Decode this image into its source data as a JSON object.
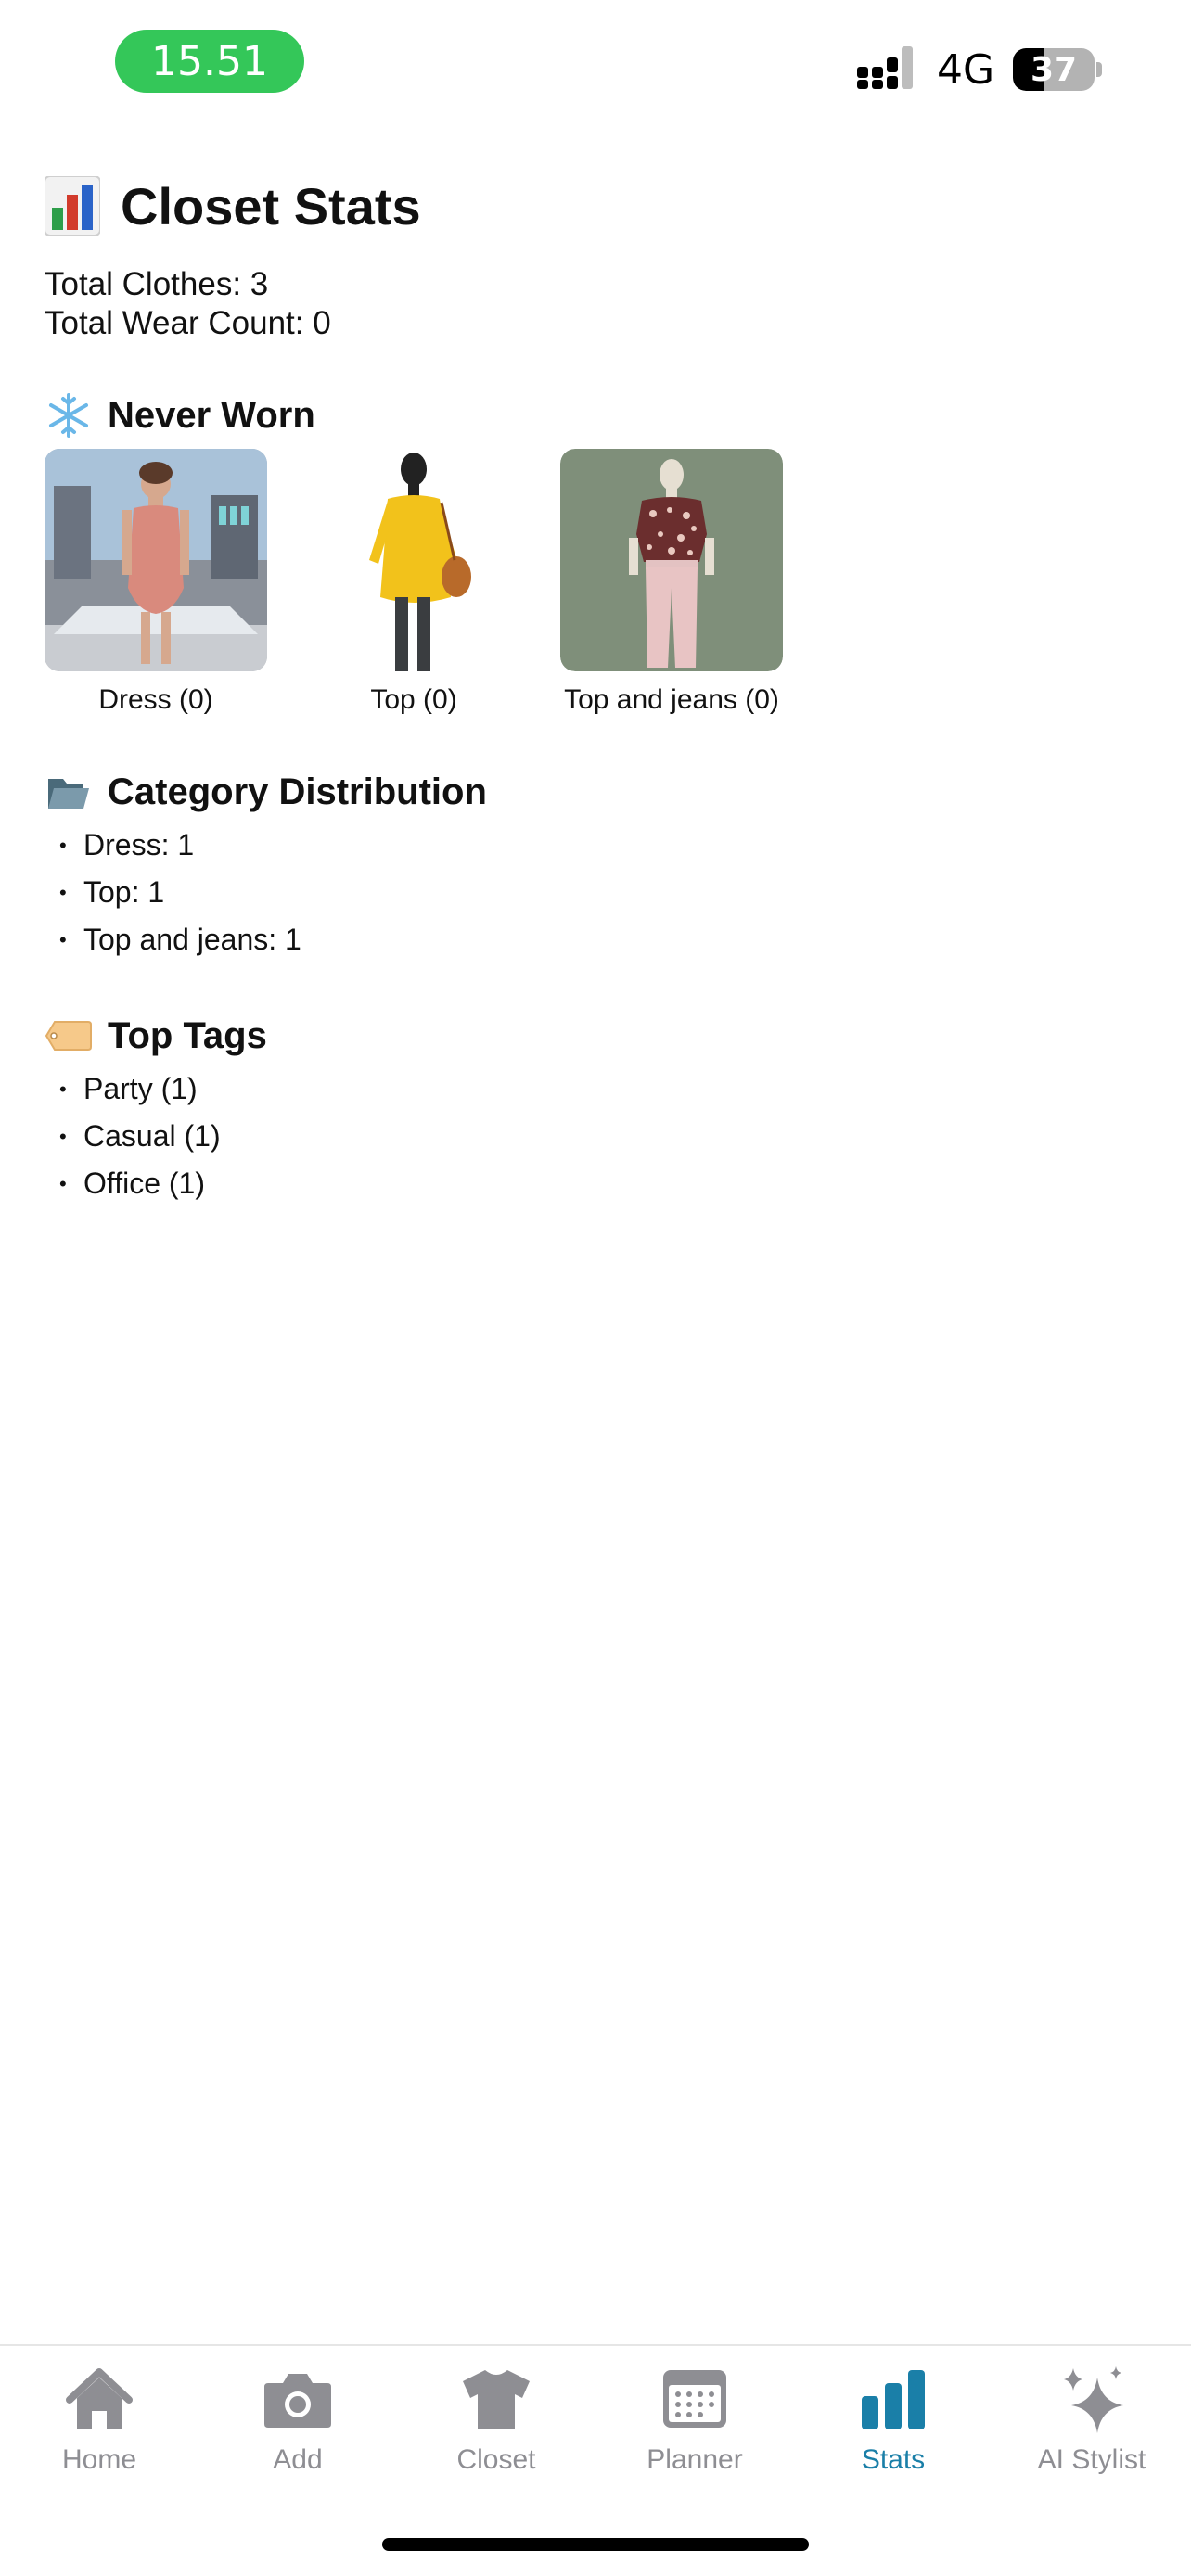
{
  "status_bar": {
    "time": "15.51",
    "network": "4G",
    "battery_percent": 37,
    "battery_label": "37"
  },
  "page": {
    "title": "Closet Stats",
    "title_icon": "bar-chart-icon",
    "total_clothes": "Total Clothes: 3",
    "total_wear_count": "Total Wear Count: 0"
  },
  "never_worn": {
    "heading": "Never Worn",
    "icon": "snowflake-icon",
    "items": [
      {
        "label": "Dress (0)",
        "thumb": "dress-photo"
      },
      {
        "label": "Top (0)",
        "thumb": "yellow-top-photo"
      },
      {
        "label": "Top and jeans (0)",
        "thumb": "top-and-jeans-photo"
      }
    ]
  },
  "category_distribution": {
    "heading": "Category Distribution",
    "icon": "folder-icon",
    "items": [
      "Dress: 1",
      "Top: 1",
      "Top and jeans: 1"
    ]
  },
  "top_tags": {
    "heading": "Top Tags",
    "icon": "tag-icon",
    "items": [
      "Party (1)",
      "Casual (1)",
      "Office (1)"
    ]
  },
  "tab_bar": {
    "tabs": [
      {
        "label": "Home",
        "icon": "home-icon"
      },
      {
        "label": "Add",
        "icon": "camera-icon"
      },
      {
        "label": "Closet",
        "icon": "tshirt-icon"
      },
      {
        "label": "Planner",
        "icon": "calendar-icon"
      },
      {
        "label": "Stats",
        "icon": "bar-chart-icon",
        "active": true
      },
      {
        "label": "AI Stylist",
        "icon": "sparkles-icon"
      }
    ],
    "active_color": "#1a7fa8",
    "inactive_color": "#8e8e93"
  },
  "colors": {
    "time_pill": "#34c759",
    "text": "#111111"
  }
}
